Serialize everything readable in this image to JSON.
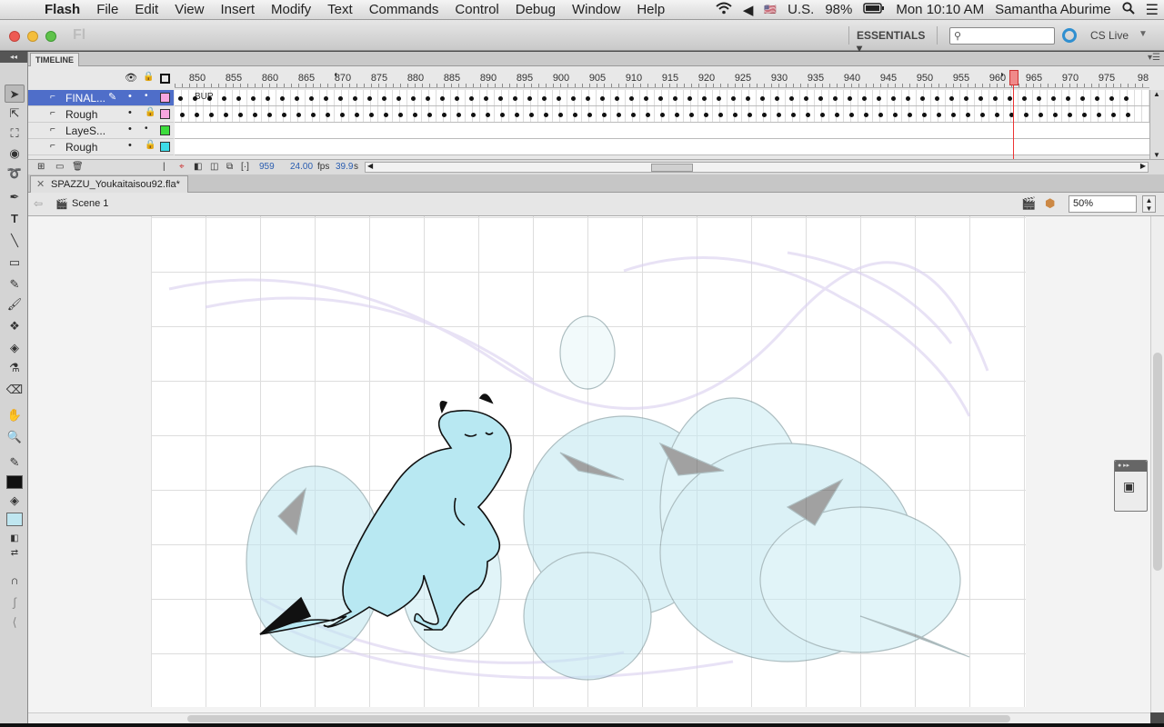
{
  "menubar": {
    "app": "Flash",
    "items": [
      "File",
      "Edit",
      "View",
      "Insert",
      "Modify",
      "Text",
      "Commands",
      "Control",
      "Debug",
      "Window",
      "Help"
    ],
    "input_source": "U.S.",
    "battery": "98%",
    "clock": "Mon 10:10 AM",
    "user": "Samantha Aburime"
  },
  "titlebar": {
    "logo": "Fl",
    "workspace": "ESSENTIALS ▾",
    "search_placeholder": "",
    "cs_live": "CS Live"
  },
  "timeline": {
    "tab": "TIMELINE",
    "ruler_labels": [
      "850",
      "855",
      "860",
      "865",
      "870",
      "875",
      "880",
      "885",
      "890",
      "895",
      "900",
      "905",
      "910",
      "915",
      "920",
      "925",
      "930",
      "935",
      "940",
      "945",
      "950",
      "955",
      "960",
      "965",
      "970",
      "975",
      "98"
    ],
    "current_frame_label": "960",
    "layers": [
      {
        "name": "FINAL...",
        "selected": true,
        "locked": false,
        "color": "#f7a6e0",
        "has_frames": true,
        "frame_label": "BUP"
      },
      {
        "name": "Rough",
        "selected": false,
        "locked": true,
        "color": "#f7a6e0",
        "has_frames": true
      },
      {
        "name": "LayeS...",
        "selected": false,
        "locked": false,
        "color": "#3ddc3d",
        "has_frames": false
      },
      {
        "name": "Rough",
        "selected": false,
        "locked": true,
        "color": "#3ddce8",
        "has_frames": false
      }
    ],
    "footer": {
      "frame": "959",
      "fps": "24.00",
      "fps_unit": "fps",
      "seconds": "39.9",
      "seconds_unit": "s"
    }
  },
  "document": {
    "tab": "SPAZZU_Youkaitaisou92.fla*",
    "scene": "Scene 1",
    "zoom": "50%"
  },
  "colors": {
    "layer_selected": "#4f6ec9",
    "playhead": "#f08a8a",
    "stroke_swatch": "#111111",
    "fill_swatch": "#bfe6f0",
    "character_fill": "#b8e8f2"
  }
}
